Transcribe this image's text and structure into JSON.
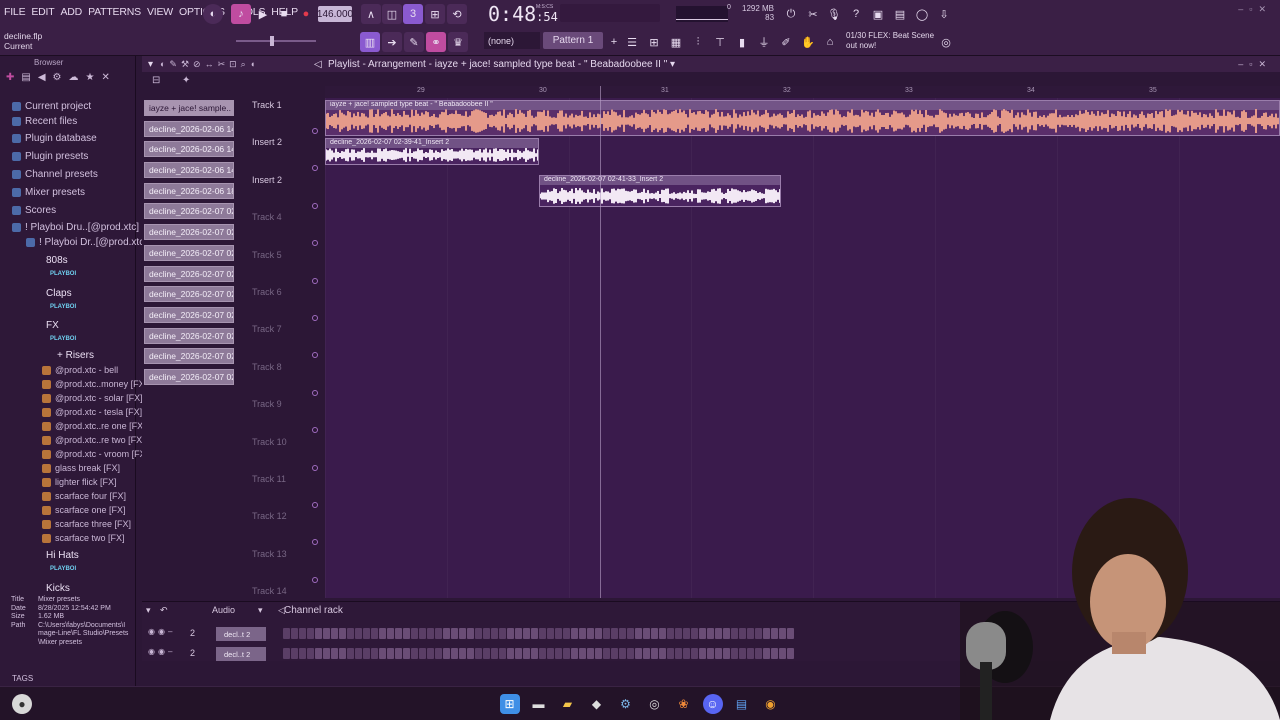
{
  "menu": [
    "FILE",
    "EDIT",
    "ADD",
    "PATTERNS",
    "VIEW",
    "OPTIONS",
    "TOOLS",
    "HELP"
  ],
  "transport": {
    "tempo": "146.000",
    "time_main": "0:48",
    "time_small": ":54",
    "time_label": "M:S:CS",
    "memory": "1292 MB",
    "cpu": "83",
    "cpu_top": "0"
  },
  "project": {
    "file": "decline.flp",
    "status": "Current"
  },
  "toolbar": {
    "snap": "(none)",
    "pattern": "Pattern 1"
  },
  "hint": {
    "line1": "01/30  FLEX: Beat Scene",
    "line2": "out now!"
  },
  "browser": {
    "title": "Browser",
    "items": [
      {
        "label": "Current project",
        "kind": "folder"
      },
      {
        "label": "Recent files",
        "kind": "folder"
      },
      {
        "label": "Plugin database",
        "kind": "folder"
      },
      {
        "label": "Plugin presets",
        "kind": "folder"
      },
      {
        "label": "Channel presets",
        "kind": "folder"
      },
      {
        "label": "Mixer presets",
        "kind": "folder"
      },
      {
        "label": "Scores",
        "kind": "folder"
      },
      {
        "label": "! Playboi Dru..[@prod.xtc]",
        "kind": "folder"
      },
      {
        "label": "! Playboi Dr..[@prod.xtc]",
        "kind": "folder"
      },
      {
        "label": "808s",
        "kind": "pack"
      },
      {
        "label": "PLAYBOI",
        "kind": "logo"
      },
      {
        "label": "Claps",
        "kind": "pack"
      },
      {
        "label": "PLAYBOI",
        "kind": "logo"
      },
      {
        "label": "FX",
        "kind": "pack"
      },
      {
        "label": "PLAYBOI",
        "kind": "logo"
      },
      {
        "label": "+ Risers",
        "kind": "pack"
      },
      {
        "label": "@prod.xtc - bell",
        "kind": "sample"
      },
      {
        "label": "@prod.xtc..money [FX]",
        "kind": "sample"
      },
      {
        "label": "@prod.xtc - solar [FX]",
        "kind": "sample"
      },
      {
        "label": "@prod.xtc - tesla [FX]",
        "kind": "sample"
      },
      {
        "label": "@prod.xtc..re one [FX]",
        "kind": "sample"
      },
      {
        "label": "@prod.xtc..re two [FX]",
        "kind": "sample"
      },
      {
        "label": "@prod.xtc - vroom [FX]",
        "kind": "sample"
      },
      {
        "label": "glass break [FX]",
        "kind": "sample"
      },
      {
        "label": "lighter flick [FX]",
        "kind": "sample"
      },
      {
        "label": "scarface four [FX]",
        "kind": "sample"
      },
      {
        "label": "scarface one [FX]",
        "kind": "sample"
      },
      {
        "label": "scarface three [FX]",
        "kind": "sample"
      },
      {
        "label": "scarface two [FX]",
        "kind": "sample"
      },
      {
        "label": "Hi Hats",
        "kind": "pack"
      },
      {
        "label": "PLAYBOI",
        "kind": "logo"
      },
      {
        "label": "Kicks",
        "kind": "pack"
      }
    ],
    "info": {
      "title_k": "Title",
      "title_v": "Mixer presets",
      "date_k": "Date",
      "date_v": "8/28/2025 12:54:42 PM",
      "size_k": "Size",
      "size_v": "1.62 MB",
      "path_k": "Path",
      "path_v": "C:\\Users\\fabys\\Documents\\Image-Line\\FL Studio\\Presets\\Mixer presets"
    },
    "tags": "TAGS"
  },
  "playlist": {
    "title": "Playlist - Arrangement",
    "subtitle": "iayze + jace! sampled type beat - \" Beabadoobee II \"",
    "clip_list": [
      "iayze + jace! sample..",
      "decline_2026-02-06 14-..",
      "decline_2026-02-06 14-..",
      "decline_2026-02-06 14-..",
      "decline_2026-02-06 18-..",
      "decline_2026-02-07 02-..",
      "decline_2026-02-07 02-..",
      "decline_2026-02-07 02-..",
      "decline_2026-02-07 02-..",
      "decline_2026-02-07 02-..",
      "decline_2026-02-07 02-..",
      "decline_2026-02-07 02-..",
      "decline_2026-02-07 02-..",
      "decline_2026-02-07 02-.."
    ],
    "tracks": [
      "Track 1",
      "Insert 2",
      "Insert 2",
      "Track 4",
      "Track 5",
      "Track 6",
      "Track 7",
      "Track 8",
      "Track 9",
      "Track 10",
      "Track 11",
      "Track 12",
      "Track 13",
      "Track 14"
    ],
    "bars": [
      "29",
      "30",
      "31",
      "32",
      "33",
      "34",
      "35"
    ],
    "clips": [
      {
        "label": "iayze + jace! sampled type beat - \" Beabadoobee II \""
      },
      {
        "label": "decline_2026-02-07 02-39-41_Insert 2"
      },
      {
        "label": "decline_2026-02-07 02-41-33_Insert 2"
      }
    ]
  },
  "channel_rack": {
    "filter": "Audio",
    "title": "Channel rack",
    "rows": [
      {
        "num": "2",
        "name": "decl..t 2"
      },
      {
        "num": "2",
        "name": "decl..t 2"
      }
    ]
  },
  "colors": {
    "accent": "#b06ad0",
    "playlist_bg": "#3a1b4c",
    "clip_waveform": "#e59a8a"
  }
}
